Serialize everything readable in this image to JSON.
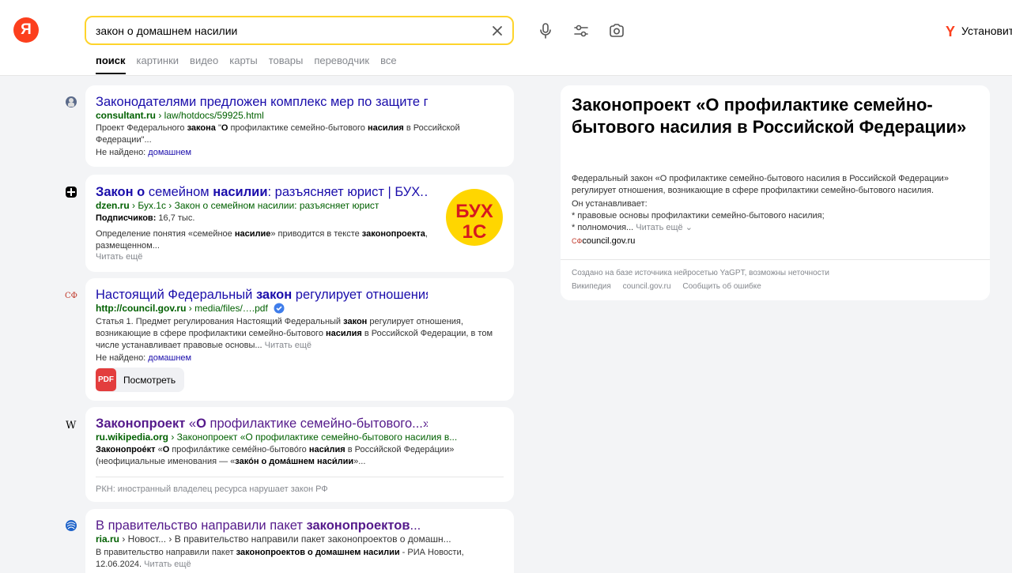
{
  "header": {
    "logo": "Я",
    "search_value": "закон о домашнем насилии",
    "browser_cta": "Установить"
  },
  "tabs": [
    "поиск",
    "картинки",
    "видео",
    "карты",
    "товары",
    "переводчик",
    "все"
  ],
  "results": [
    {
      "title": "Законодателями предложен комплекс мер по защите прав...",
      "host": "consultant.ru",
      "path": " › law/hotdocs/59925.html",
      "snippet_1": "Проект Федерального ",
      "snippet_2": "закона",
      "snippet_3": " \"",
      "snippet_4": "О",
      "snippet_5": " профилактике семейно-бытового ",
      "snippet_6": "насилия",
      "snippet_7": " в Российской Федерации\"...",
      "notfound_label": "Не найдено: ",
      "notfound_word": "домашнем"
    },
    {
      "title_b1": "Закон о",
      "title_n1": " семейном ",
      "title_b2": "насилии",
      "title_n2": ": разъясняет юрист | БУХ.…",
      "host": "dzen.ru",
      "path": " › Бух.1с › Закон о семейном насилии: разъясняет юрист",
      "subs_label": "Подписчиков:",
      "subs_value": " 16,7 тыс.",
      "snippet_1": "Определение понятия «семейное ",
      "snippet_2": "насилие",
      "snippet_3": "» приводится в тексте ",
      "snippet_4": "законопроекта",
      "snippet_5": ", размещенном...",
      "read_more": "Читать ещё",
      "logo_text_top": "БУХ",
      "logo_text_bottom": "1С"
    },
    {
      "title_n1": "Настоящий Федеральный ",
      "title_b1": "закон",
      "title_n2": " регулирует отношения...",
      "host": "http://council.gov.ru",
      "path": " › media/files/….pdf",
      "snippet_1": "Статья 1. Предмет регулирования Настоящий Федеральный ",
      "snippet_2": "закон",
      "snippet_3": " регулирует отношения, возникающие в сфере профилактики семейно-бытового ",
      "snippet_4": "насилия",
      "snippet_5": " в Российской Федерации, в том числе устанавливает правовые основы...",
      "read_more": " Читать ещё",
      "notfound_label": "Не найдено: ",
      "notfound_word": "домашнем",
      "pdf_badge": "PDF",
      "pdf_label": "Посмотреть"
    },
    {
      "title_b1": "Законопроект",
      "title_n1": " «",
      "title_b2": "О",
      "title_n2": " профилактике семейно-бытового...»",
      "host": "ru.wikipedia.org",
      "path": " › Законопроект «О профилактике семейно-бытового насилия в...",
      "snippet_1": "Законопрое́кт",
      "snippet_2": " «",
      "snippet_3": "О",
      "snippet_4": " профила́ктике семе́йно-бытово́го ",
      "snippet_5": "наси́лия",
      "snippet_6": " в Росси́йской Федера́ции» (неофициальные именования — «",
      "snippet_7": "зако́н о дома́шнем наси́лии",
      "snippet_8": "»...",
      "rkn": "РКН: иностранный владелец ресурса нарушает закон РФ"
    },
    {
      "title_n1": "В правительство направили пакет ",
      "title_b1": "законопроектов",
      "title_n2": "...",
      "host": "ria.ru",
      "path": " › Новост... › В правительство направили пакет законопроектов о домашн...",
      "snippet_1": "В правительство направили пакет ",
      "snippet_2": "законопроектов о домашнем насилии",
      "snippet_3": " - РИА Новости, 12.06.2024.",
      "read_more": " Читать ещё"
    }
  ],
  "fact": {
    "title": "Законопроект «О профилактике семейно-бытового насилия в Российской Федерации»",
    "text_1": "Федеральный закон «О профилактике семейно-бытового насилия в Российской Федерации» регулирует отношения, возникающие в сфере профилактики семейно-бытового насилия.",
    "text_2": "Он устанавливает:",
    "text_3": "* правовые основы профилактики семейно-бытового насилия;",
    "text_4": "* полномочия...",
    "read_more": " Читать ещё",
    "source": "council.gov.ru",
    "disclaimer": "Создано на базе источника нейросетью YaGPT, возможны неточности",
    "link_1": "Википедия",
    "link_2": "council.gov.ru",
    "link_3": "Сообщить об ошибке"
  },
  "colors": {
    "accent": "#fed42b",
    "brand": "#fc3f1d",
    "link": "#1a0dab",
    "visited": "#551a8b",
    "url": "#006000"
  }
}
